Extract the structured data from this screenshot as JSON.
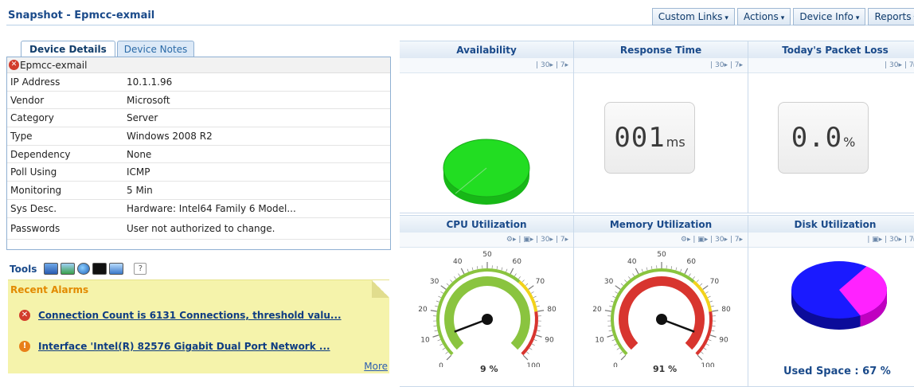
{
  "page": {
    "title": "Snapshot - Epmcc-exmail"
  },
  "topmenu": [
    {
      "label": "Custom Links",
      "chev": "▾"
    },
    {
      "label": "Actions",
      "chev": "▾"
    },
    {
      "label": "Device Info",
      "chev": "▾"
    },
    {
      "label": "Reports",
      "chev": "▾"
    }
  ],
  "tabs": {
    "details": "Device Details",
    "notes": "Device Notes"
  },
  "device": {
    "name": "Epmcc-exmail",
    "rows": [
      {
        "key": "IP Address",
        "value": "10.1.1.96"
      },
      {
        "key": "Vendor",
        "value": "Microsoft"
      },
      {
        "key": "Category",
        "value": "Server"
      },
      {
        "key": "Type",
        "value": "Windows 2008 R2"
      },
      {
        "key": "Dependency",
        "value": "None"
      },
      {
        "key": "Poll Using",
        "value": "ICMP"
      },
      {
        "key": "Monitoring",
        "value": "5 Min"
      },
      {
        "key": "Sys Desc.",
        "value": "Hardware: Intel64 Family 6 Model..."
      },
      {
        "key": "Passwords",
        "value": "User not authorized to change."
      }
    ]
  },
  "tools": {
    "label": "Tools",
    "help": "?"
  },
  "alarms": {
    "header": "Recent Alarms",
    "items": [
      {
        "text": "Connection Count is 6131 Connections, threshold valu...",
        "severity": "critical"
      },
      {
        "text": "Interface 'Intel(R) 82576 Gigabit Dual Port Network ...",
        "severity": "major"
      }
    ],
    "more": "More"
  },
  "widgets": {
    "availability": {
      "title": "Availability",
      "links": "| 30▸ | 7▸"
    },
    "response": {
      "title": "Response Time",
      "links": "| 30▸ | 7▸",
      "value": "001",
      "unit": "ms"
    },
    "packet_loss": {
      "title": "Today's Packet Loss",
      "links": "| 30▸ | 7▸",
      "value": "0.0",
      "unit": "%"
    },
    "cpu": {
      "title": "CPU Utilization",
      "links": "⚙▸ | ▣▸ | 30▸ | 7▸",
      "value": 9,
      "label": "9 %"
    },
    "memory": {
      "title": "Memory Utilization",
      "links": "⚙▸ | ▣▸ | 30▸ | 7▸",
      "value": 91,
      "label": "91 %"
    },
    "disk": {
      "title": "Disk Utilization",
      "links": "| ▣▸ | 30▸ | 7▸",
      "used_label": "Used Space : 67 %",
      "used_pct": 67
    }
  },
  "gauge_ticks": [
    "0",
    "10",
    "20",
    "30",
    "40",
    "50",
    "60",
    "70",
    "80",
    "90",
    "100"
  ],
  "colors": {
    "availability": "#22dd22",
    "disk_used": "#ff22ff",
    "disk_free": "#1a1aff",
    "gauge_green": "#8ac43f",
    "gauge_red": "#d8352f",
    "gauge_yellow": "#f2d21b"
  }
}
